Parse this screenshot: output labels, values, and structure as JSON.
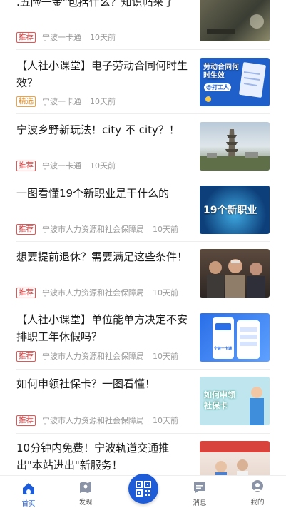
{
  "feed": {
    "items": [
      {
        "title": ".五险一金\"包括什么？知识帖来了",
        "tag": "推荐",
        "source": "宁波一卡通",
        "time": "10天前"
      },
      {
        "title": "【人社小课堂】电子劳动合同何时生效？",
        "tag": "精选",
        "source": "宁波一卡通",
        "time": "10天前",
        "thumb_text": "劳动合同何时生效",
        "thumb_sub": "@打工人"
      },
      {
        "title": "宁波乡野新玩法！city 不 city？！",
        "tag": "推荐",
        "source": "宁波一卡通",
        "time": "10天前"
      },
      {
        "title": "一图看懂19个新职业是干什么的",
        "tag": "推荐",
        "source": "宁波市人力资源和社会保障局",
        "time": "10天前",
        "thumb_text": "19个新职业"
      },
      {
        "title": "想要提前退休？需要满足这些条件！",
        "tag": "推荐",
        "source": "宁波市人力资源和社会保障局",
        "time": "10天前"
      },
      {
        "title": "【人社小课堂】单位能单方决定不安排职工年休假吗？",
        "tag": "推荐",
        "source": "宁波市人力资源和社会保障局",
        "time": "10天前",
        "thumb_text": "宁波一卡通"
      },
      {
        "title": "如何申领社保卡？一图看懂！",
        "tag": "推荐",
        "source": "宁波市人力资源和社会保障局",
        "time": "10天前",
        "thumb_text": "如何申领社保卡"
      },
      {
        "title": "10分钟内免费！宁波轨道交通推出\"本站进出\"新服务！",
        "tag": "",
        "source": "",
        "time": ""
      }
    ]
  },
  "tabbar": {
    "tabs": [
      {
        "label": "首页",
        "icon": "home-icon"
      },
      {
        "label": "发现",
        "icon": "map-icon"
      },
      {
        "label": "",
        "icon": "qr-code-icon"
      },
      {
        "label": "消息",
        "icon": "message-icon"
      },
      {
        "label": "我的",
        "icon": "user-icon"
      }
    ]
  },
  "colors": {
    "accent": "#1e5bd6",
    "tag_red": "#d94040",
    "tag_orange": "#e08a1e"
  }
}
